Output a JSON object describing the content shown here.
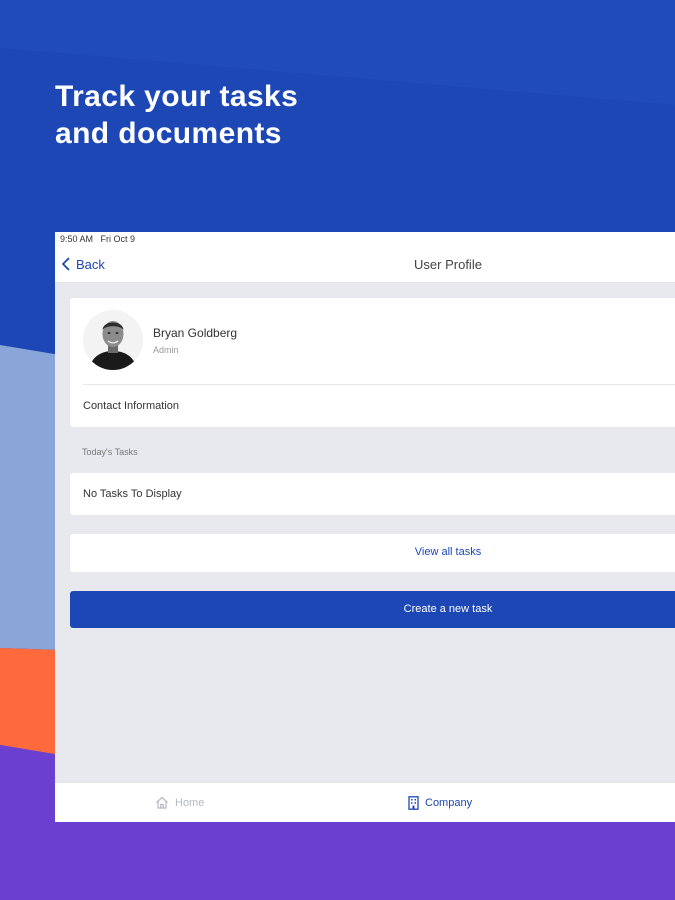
{
  "headline": {
    "line1": "Track your tasks",
    "line2": "and documents"
  },
  "status_bar": {
    "time": "9:50 AM",
    "date": "Fri Oct 9"
  },
  "nav": {
    "back_label": "Back",
    "title": "User Profile"
  },
  "profile": {
    "name": "Bryan Goldberg",
    "role": "Admin",
    "contact_label": "Contact Information"
  },
  "tasks": {
    "section_label": "Today's Tasks",
    "empty_message": "No Tasks To Display",
    "view_all_label": "View all tasks",
    "create_label": "Create a new task"
  },
  "tab_bar": {
    "items": [
      {
        "label": "Home",
        "icon": "home-icon",
        "active": false
      },
      {
        "label": "Company",
        "icon": "building-icon",
        "active": true
      }
    ]
  },
  "colors": {
    "brand_blue": "#1c47b5",
    "light_blue_band": "#8aa5d8",
    "orange_band": "#ff6a3d",
    "purple_band": "#6b3fcf",
    "screen_background": "#e7e9ee"
  }
}
